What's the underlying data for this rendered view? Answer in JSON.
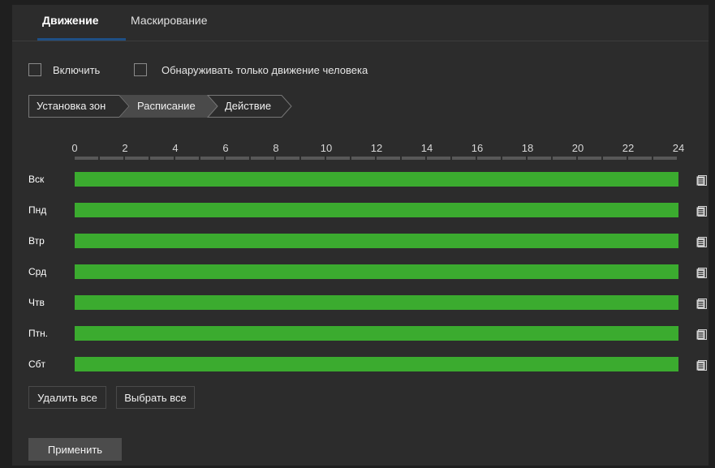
{
  "tabs": [
    {
      "label": "Движение",
      "active": true
    },
    {
      "label": "Маскирование",
      "active": false
    }
  ],
  "checkboxes": [
    {
      "label": "Включить",
      "checked": false
    },
    {
      "label": "Обнаруживать только движение человека",
      "checked": false
    }
  ],
  "steps": [
    {
      "label": "Установка зон",
      "active": false
    },
    {
      "label": "Расписание",
      "active": true
    },
    {
      "label": "Действие",
      "active": false
    }
  ],
  "hour_labels": [
    "0",
    "2",
    "4",
    "6",
    "8",
    "10",
    "12",
    "14",
    "16",
    "18",
    "20",
    "22",
    "24"
  ],
  "days": [
    {
      "label": "Вск",
      "schedule_fraction": 1.0
    },
    {
      "label": "Пнд",
      "schedule_fraction": 1.0
    },
    {
      "label": "Втр",
      "schedule_fraction": 1.0
    },
    {
      "label": "Срд",
      "schedule_fraction": 1.0
    },
    {
      "label": "Чтв",
      "schedule_fraction": 1.0
    },
    {
      "label": "Птн.",
      "schedule_fraction": 1.0
    },
    {
      "label": "Сбт",
      "schedule_fraction": 1.0
    }
  ],
  "buttons": {
    "delete_all": "Удалить все",
    "select_all": "Выбрать все",
    "apply": "Применить"
  },
  "colors": {
    "schedule_fill": "#3bab2f",
    "tab_underline": "#1f4f85",
    "background": "#2c2c2c"
  },
  "icons": {
    "copy": "copy-schedule-icon"
  }
}
